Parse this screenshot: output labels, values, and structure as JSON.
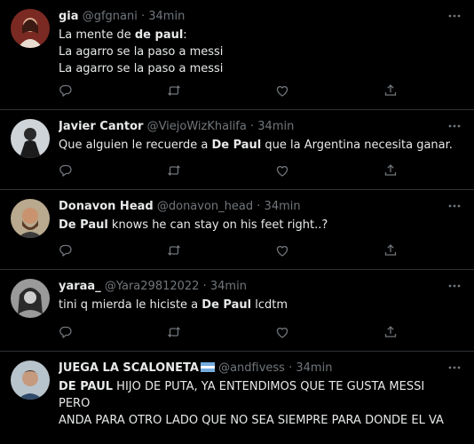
{
  "tweets": [
    {
      "name": "gia",
      "handle": "@gfgnani",
      "dot": "·",
      "time": "34min",
      "lines": [
        [
          {
            "t": "La mente de ",
            "b": false
          },
          {
            "t": "de paul",
            "b": true
          },
          {
            "t": ":",
            "b": false
          }
        ],
        [
          {
            "t": "La agarro se la paso a messi",
            "b": false
          }
        ],
        [
          {
            "t": "La agarro se la paso a messi",
            "b": false
          }
        ]
      ]
    },
    {
      "name": "Javier Cantor",
      "handle": "@ViejoWizKhalifa",
      "dot": "·",
      "time": "34min",
      "lines": [
        [
          {
            "t": "Que alguien le recuerde a ",
            "b": false
          },
          {
            "t": "De Paul",
            "b": true
          },
          {
            "t": " que la Argentina necesita ganar.",
            "b": false
          }
        ]
      ]
    },
    {
      "name": "Donavon Head",
      "handle": "@donavon_head",
      "dot": "·",
      "time": "34min",
      "lines": [
        [
          {
            "t": "De Paul",
            "b": true
          },
          {
            "t": " knows he can stay on his feet right..?",
            "b": false
          }
        ]
      ]
    },
    {
      "name": "yaraa_",
      "handle": "@Yara29812022",
      "dot": "·",
      "time": "34min",
      "lines": [
        [
          {
            "t": "tini q mierda le hiciste a ",
            "b": false
          },
          {
            "t": "De Paul",
            "b": true
          },
          {
            "t": " lcdtm",
            "b": false
          }
        ]
      ]
    },
    {
      "name": "JUEGA LA SCALONETA",
      "handle": "@andfivess",
      "dot": "·",
      "time": "34min",
      "lines": [
        [
          {
            "t": "DE PAUL",
            "b": true
          },
          {
            "t": " HIJO DE PUTA, YA ENTENDIMOS QUE TE GUSTA MESSI PERO",
            "b": false
          }
        ],
        [
          {
            "t": "ANDA PARA OTRO LADO QUE NO SEA SIEMPRE PARA DONDE EL VA",
            "b": false
          }
        ]
      ]
    }
  ],
  "icons": {
    "reply": "reply-icon",
    "retweet": "retweet-icon",
    "like": "like-icon",
    "share": "share-icon",
    "more": "more-icon"
  },
  "colors": {
    "background": "#000000",
    "text": "#e7e9ea",
    "secondary": "#71767b",
    "divider": "#2f3336",
    "flag_blue": "#74acdf"
  }
}
